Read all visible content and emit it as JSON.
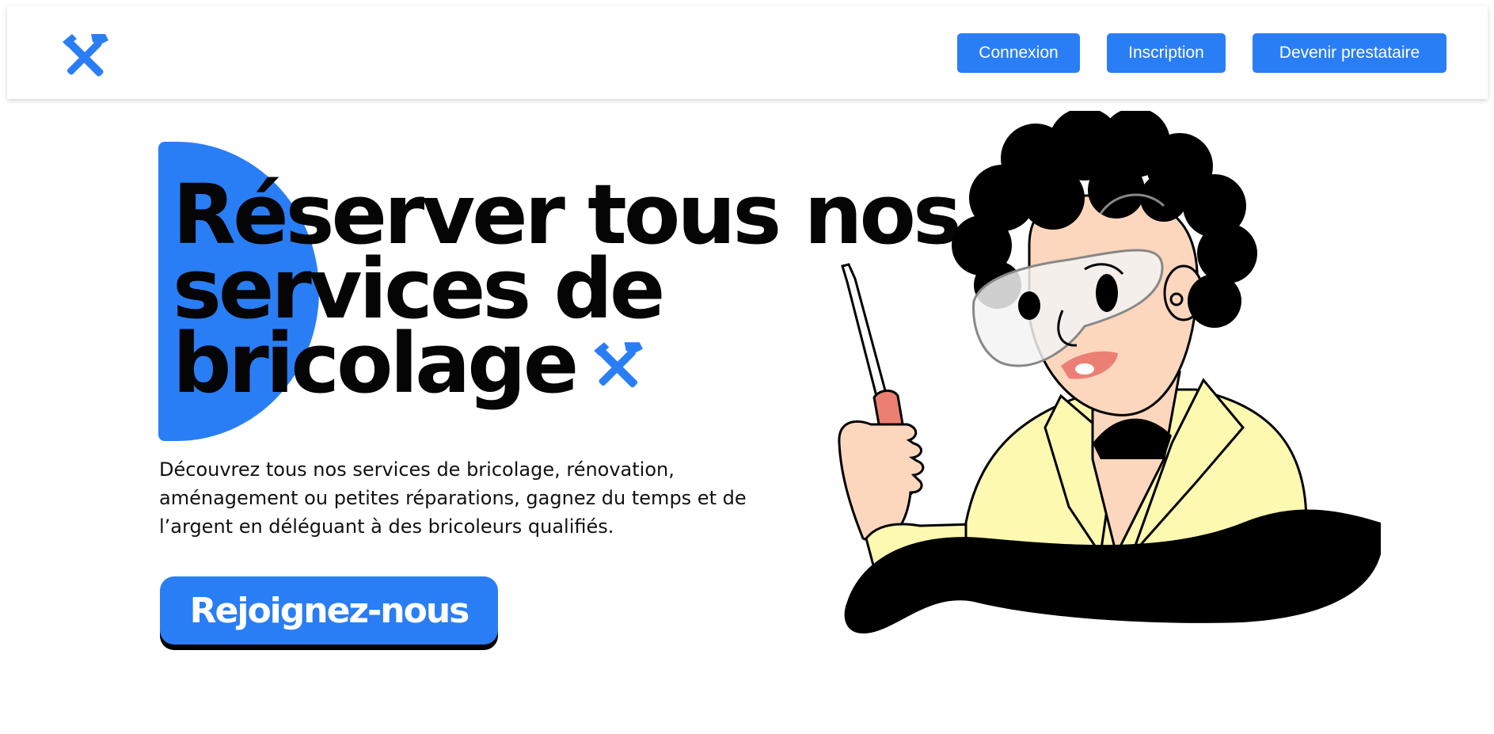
{
  "header": {
    "logo_icon": "hammer-wrench-icon",
    "buttons": {
      "login": "Connexion",
      "signup": "Inscription",
      "provider": "Devenir prestataire"
    }
  },
  "hero": {
    "title_lines": [
      "Réserver tous nos",
      "services de",
      "bricolage"
    ],
    "title_icon": "hammer-wrench-icon",
    "description": "Découvrez tous nos services de bricolage, rénovation, aménagement ou petites réparations, gagnez du temps et de l’argent en déléguant à des bricoleurs qualifiés.",
    "cta_label": "Rejoignez-nous",
    "illustration": "woman-with-safety-goggles-and-screwdriver"
  },
  "colors": {
    "accent": "#2a7ef5",
    "text": "#050505",
    "background": "#ffffff",
    "jacket": "#fdf9b0",
    "skin": "#fcd7be",
    "lips": "#ec7f73"
  }
}
